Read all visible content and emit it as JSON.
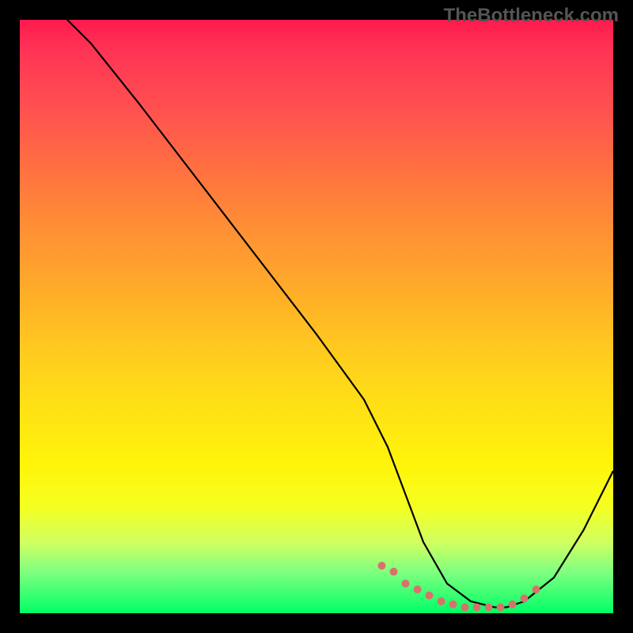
{
  "watermark": "TheBottleneck.com",
  "chart_data": {
    "type": "line",
    "title": "",
    "xlabel": "",
    "ylabel": "",
    "xlim": [
      0,
      100
    ],
    "ylim": [
      0,
      100
    ],
    "series": [
      {
        "name": "curve",
        "x": [
          8,
          12,
          20,
          30,
          40,
          50,
          58,
          62,
          65,
          68,
          72,
          76,
          80,
          82,
          85,
          90,
          95,
          100
        ],
        "values": [
          100,
          96,
          86,
          73,
          60,
          47,
          36,
          28,
          20,
          12,
          5,
          2,
          1,
          1,
          2,
          6,
          14,
          24
        ]
      }
    ],
    "markers": {
      "name": "highlight-dots",
      "color": "#d9716b",
      "x": [
        61,
        63,
        65,
        67,
        69,
        71,
        73,
        75,
        77,
        79,
        81,
        83,
        85,
        87
      ],
      "values": [
        8,
        7,
        5,
        4,
        3,
        2,
        1.5,
        1,
        1,
        1,
        1,
        1.5,
        2.5,
        4
      ]
    }
  }
}
